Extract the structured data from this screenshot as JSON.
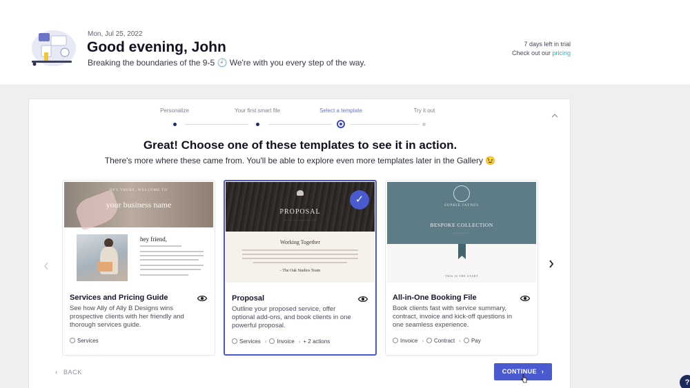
{
  "header": {
    "date": "Mon, Jul 25, 2022",
    "greeting": "Good evening, John",
    "subtitle": "Breaking the boundaries of the 9-5 🕘 We're with you every step of the way.",
    "trial_text": "7 days left in trial",
    "trial_prefix": "Check out our ",
    "trial_link": "pricing"
  },
  "stepper": {
    "steps": [
      {
        "label": "Personalize",
        "state": "done"
      },
      {
        "label": "Your first smart file",
        "state": "done"
      },
      {
        "label": "Select a template",
        "state": "current"
      },
      {
        "label": "Try it out",
        "state": "future"
      }
    ]
  },
  "main": {
    "title": "Great! Choose one of these templates to see it in action.",
    "subtitle": "There's more where these came from. You'll be able to explore even more templates later in the Gallery 😉"
  },
  "templates": [
    {
      "name": "Services and Pricing Guide",
      "description": "See how Ally of Ally B Designs wins prospective clients with her friendly and thorough services guide.",
      "tags": [
        "Services"
      ],
      "selected": false,
      "preview": {
        "small_heading": "HEY THERE, WELCOME TO",
        "title": "your business name",
        "greeting": "hey friend,"
      }
    },
    {
      "name": "Proposal",
      "description": "Outline your proposed service, offer optional add-ons, and book clients in one powerful proposal.",
      "tags": [
        "Services",
        "Invoice",
        "+ 2 actions"
      ],
      "selected": true,
      "preview": {
        "title": "PROPOSAL",
        "subtitle": "Working Together",
        "signature": "- The Oak Studios Team"
      }
    },
    {
      "name": "All-in-One Booking File",
      "description": "Book clients fast with service summary, contract, invoice and kick-off questions in one seamless experience.",
      "tags": [
        "Invoice",
        "Contract",
        "Pay"
      ],
      "selected": false,
      "preview": {
        "name": "SOPHIE JAYNES",
        "title": "BESPOKE COLLECTION",
        "footer": "THIS IS THE START"
      }
    }
  ],
  "footer": {
    "back_label": "BACK",
    "continue_label": "CONTINUE",
    "help_label": "?"
  },
  "icons": {
    "check": "check-icon",
    "eye": "eye-icon",
    "collapse": "chevron-up-icon",
    "prev": "chevron-left-icon",
    "next": "chevron-right-icon"
  },
  "colors": {
    "accent": "#4a5ad0",
    "link": "#2bb7c0",
    "stepper_done": "#1f2a66"
  }
}
